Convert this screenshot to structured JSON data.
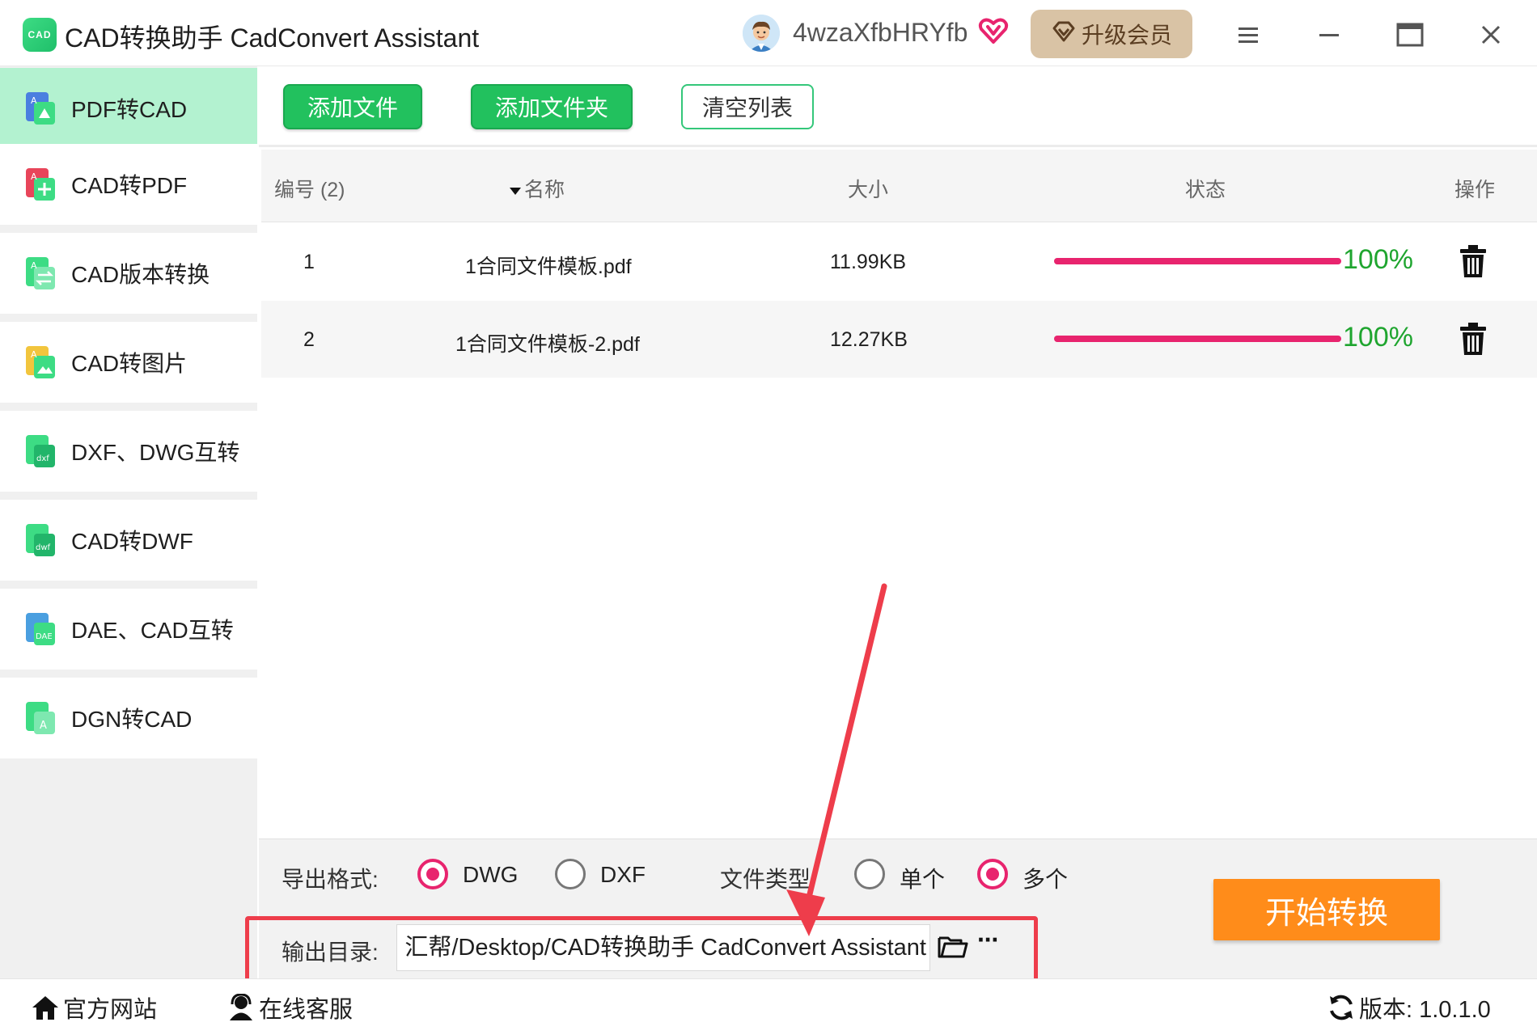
{
  "titlebar": {
    "app_logo_text": "CAD",
    "app_title": "CAD转换助手 CadConvert Assistant",
    "username": "4wzaXfbHRYfb",
    "upgrade_label": "升级会员",
    "icons": [
      "avatar",
      "vip-heart-icon",
      "gem-icon",
      "menu-icon",
      "minimize-icon",
      "maximize-icon",
      "close-icon"
    ]
  },
  "sidebar": {
    "items": [
      {
        "label": "PDF转CAD",
        "icon": "pdf-to-cad-icon",
        "active": true
      },
      {
        "label": "CAD转PDF",
        "icon": "cad-to-pdf-icon",
        "active": false
      },
      {
        "label": "CAD版本转换",
        "icon": "cad-version-icon",
        "active": false
      },
      {
        "label": "CAD转图片",
        "icon": "cad-to-image-icon",
        "active": false
      },
      {
        "label": "DXF、DWG互转",
        "icon": "dxf-dwg-icon",
        "active": false
      },
      {
        "label": "CAD转DWF",
        "icon": "cad-to-dwf-icon",
        "active": false
      },
      {
        "label": "DAE、CAD互转",
        "icon": "dae-cad-icon",
        "active": false
      },
      {
        "label": "DGN转CAD",
        "icon": "dgn-to-cad-icon",
        "active": false
      }
    ]
  },
  "toolbar": {
    "add_file": "添加文件",
    "add_folder": "添加文件夹",
    "clear_list": "清空列表"
  },
  "table": {
    "columns": {
      "index": "编号 (2)",
      "name": "名称",
      "size": "大小",
      "status": "状态",
      "action": "操作"
    },
    "rows": [
      {
        "index": "1",
        "name": "1合同文件模板.pdf",
        "size": "11.99KB",
        "progress": 100,
        "progress_label": "100%"
      },
      {
        "index": "2",
        "name": "1合同文件模板-2.pdf",
        "size": "12.27KB",
        "progress": 100,
        "progress_label": "100%"
      }
    ]
  },
  "settings": {
    "export_format_label": "导出格式:",
    "formats": [
      {
        "label": "DWG",
        "selected": true
      },
      {
        "label": "DXF",
        "selected": false
      }
    ],
    "file_type_label": "文件类型",
    "file_types": [
      {
        "label": "单个",
        "selected": false
      },
      {
        "label": "多个",
        "selected": true
      }
    ],
    "output_dir_label": "输出目录:",
    "output_dir_value": "汇帮/Desktop/CAD转换助手 CadConvert Assistant",
    "more_label": "···",
    "start_button": "开始转换"
  },
  "statusbar": {
    "website": "官方网站",
    "support": "在线客服",
    "version": "版本: 1.0.1.0"
  },
  "colors": {
    "accent_green": "#22c15e",
    "active_tab": "#b3f2d0",
    "progress": "#e8246e",
    "percent_text": "#1fa52f",
    "start_button": "#ff8c1a",
    "highlight": "#ee3d4b"
  }
}
